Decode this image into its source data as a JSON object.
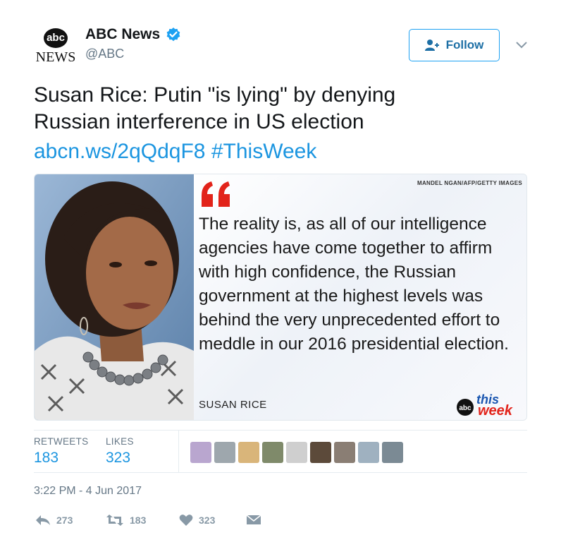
{
  "account": {
    "avatar_top": "abc",
    "avatar_bottom": "NEWS",
    "name": "ABC News",
    "handle": "@ABC",
    "follow_label": "Follow"
  },
  "tweet": {
    "line1": "Susan Rice: Putin \"is lying\" by denying",
    "line2": "Russian interference in US election",
    "link": "abcn.ws/2qQdqF8",
    "hashtag": "#ThisWeek"
  },
  "media": {
    "credit": "MANDEL NGAN/AFP/GETTY IMAGES",
    "quote": "The reality is, as all of our intelligence agencies have come together to affirm with high confidence, the Russian government at the highest levels was behind the very unprecedented effort to meddle in our 2016 presidential election.",
    "speaker": "SUSAN RICE",
    "logo_abc": "abc",
    "logo_this": "this",
    "logo_week": "week"
  },
  "stats": {
    "retweets_label": "RETWEETS",
    "retweets_value": "183",
    "likes_label": "LIKES",
    "likes_value": "323"
  },
  "likers_colors": [
    "#b9a6cf",
    "#9ea7ad",
    "#d9b57a",
    "#7f8a6a",
    "#cfcfcf",
    "#5c4a3a",
    "#8a7e74",
    "#9fb1c0",
    "#7b8a94"
  ],
  "timestamp": "3:22 PM - 4 Jun 2017",
  "actions": {
    "reply_count": "273",
    "retweet_count": "183",
    "like_count": "323"
  },
  "colors": {
    "accent": "#1da1f2",
    "link": "#1b95e0",
    "verified": "#1da1f2",
    "quote_red": "#e2231a"
  }
}
